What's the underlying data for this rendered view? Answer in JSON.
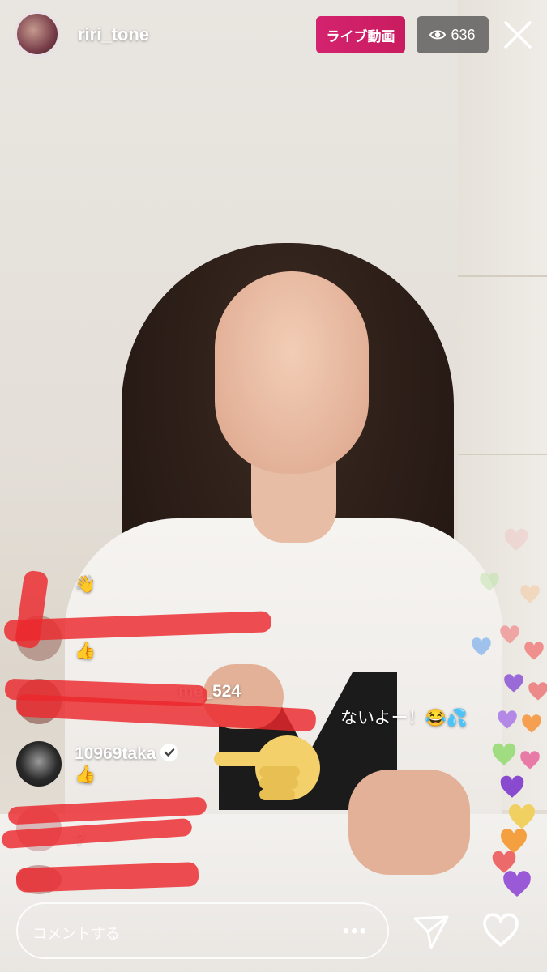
{
  "header": {
    "username": "riri_tone",
    "live_label": "ライブ動画",
    "viewer_count": "636",
    "eye_icon": "eye-icon",
    "close_icon": "close-icon"
  },
  "comments": [
    {
      "user": "",
      "text": "👋"
    },
    {
      "user": "",
      "text": "👍"
    },
    {
      "user": "me_524",
      "text": "ないよー！😂💦"
    },
    {
      "user": "10969taka",
      "text": "👍",
      "verified": true
    },
    {
      "user": "",
      "text": "?"
    },
    {
      "user": "",
      "text": ""
    }
  ],
  "composer": {
    "placeholder": "コメントする",
    "more_label": "•••"
  },
  "actions": {
    "send_icon": "send-icon",
    "like_icon": "heart-icon"
  },
  "colors": {
    "live_badge": "#d4236f",
    "viewer_pill": "#464646",
    "redaction": "#eb282d"
  }
}
